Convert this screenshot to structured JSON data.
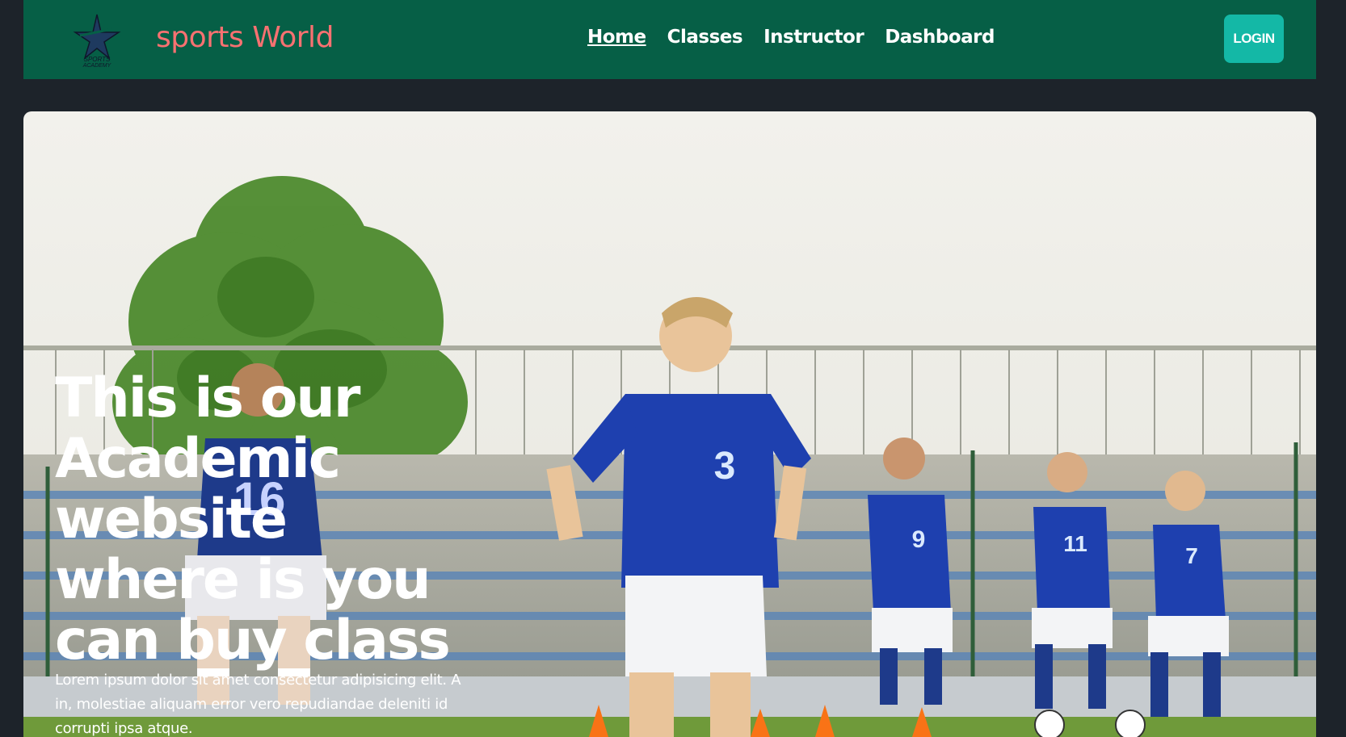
{
  "navbar": {
    "logo_text_top": "SPORTS",
    "logo_text_bottom": "ACADEMY",
    "brand": "sports World",
    "links": [
      {
        "label": "Home",
        "active": true
      },
      {
        "label": "Classes",
        "active": false
      },
      {
        "label": "Instructor",
        "active": false
      },
      {
        "label": "Dashboard",
        "active": false
      }
    ],
    "login_label": "LOGIN"
  },
  "hero": {
    "title": "This is our Academic website where is you can buy class",
    "description": "Lorem ipsum dolor sit amet consectetur adipisicing elit. A in, molestiae aliquam error vero repudiandae deleniti id corrupti ipsa atque.",
    "jersey_numbers": [
      "16",
      "3",
      "9",
      "11",
      "7"
    ]
  },
  "colors": {
    "navbar_bg": "#065f46",
    "brand": "#f87171",
    "login_bg": "#14b8a6",
    "page_bg": "#1d232a",
    "jersey": "#1e3a8a"
  }
}
